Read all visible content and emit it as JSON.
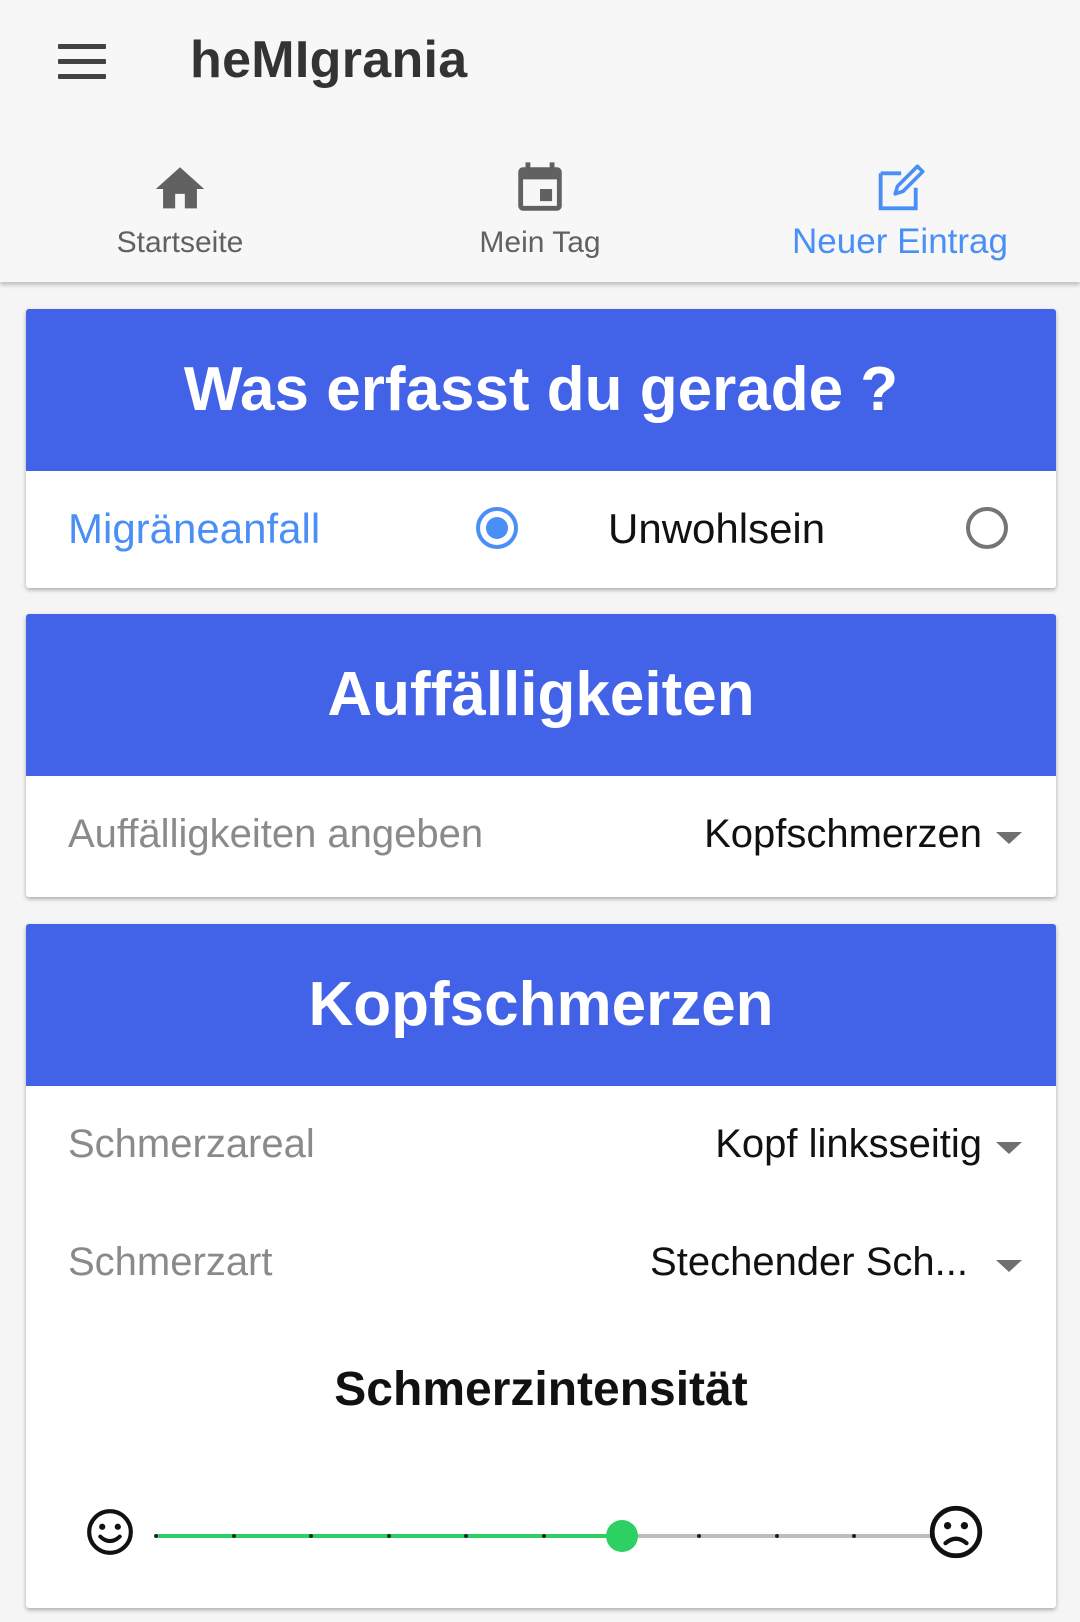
{
  "app": {
    "title": "heMIgrania"
  },
  "tabs": [
    {
      "label": "Startseite",
      "icon": "home-icon",
      "active": false
    },
    {
      "label": "Mein Tag",
      "icon": "calendar-icon",
      "active": false
    },
    {
      "label": "Neuer Eintrag",
      "icon": "edit-icon",
      "active": true
    }
  ],
  "entry_type": {
    "header": "Was erfasst du gerade ?",
    "options": [
      {
        "label": "Migräneanfall",
        "checked": true
      },
      {
        "label": "Unwohlsein",
        "checked": false
      }
    ]
  },
  "symptoms": {
    "header": "Auffälligkeiten",
    "label": "Auffälligkeiten angeben",
    "value": "Kopfschmerzen"
  },
  "headache": {
    "header": "Kopfschmerzen",
    "area_label": "Schmerzareal",
    "area_value": "Kopf linksseitig",
    "type_label": "Schmerzart",
    "type_value": "Stechender Sch...",
    "intensity_title": "Schmerzintensität",
    "intensity": {
      "min": 0,
      "max": 10,
      "value": 6
    }
  },
  "colors": {
    "accent": "#4a8ff5",
    "header_bg": "#4262e8",
    "slider_active": "#2ed063"
  }
}
